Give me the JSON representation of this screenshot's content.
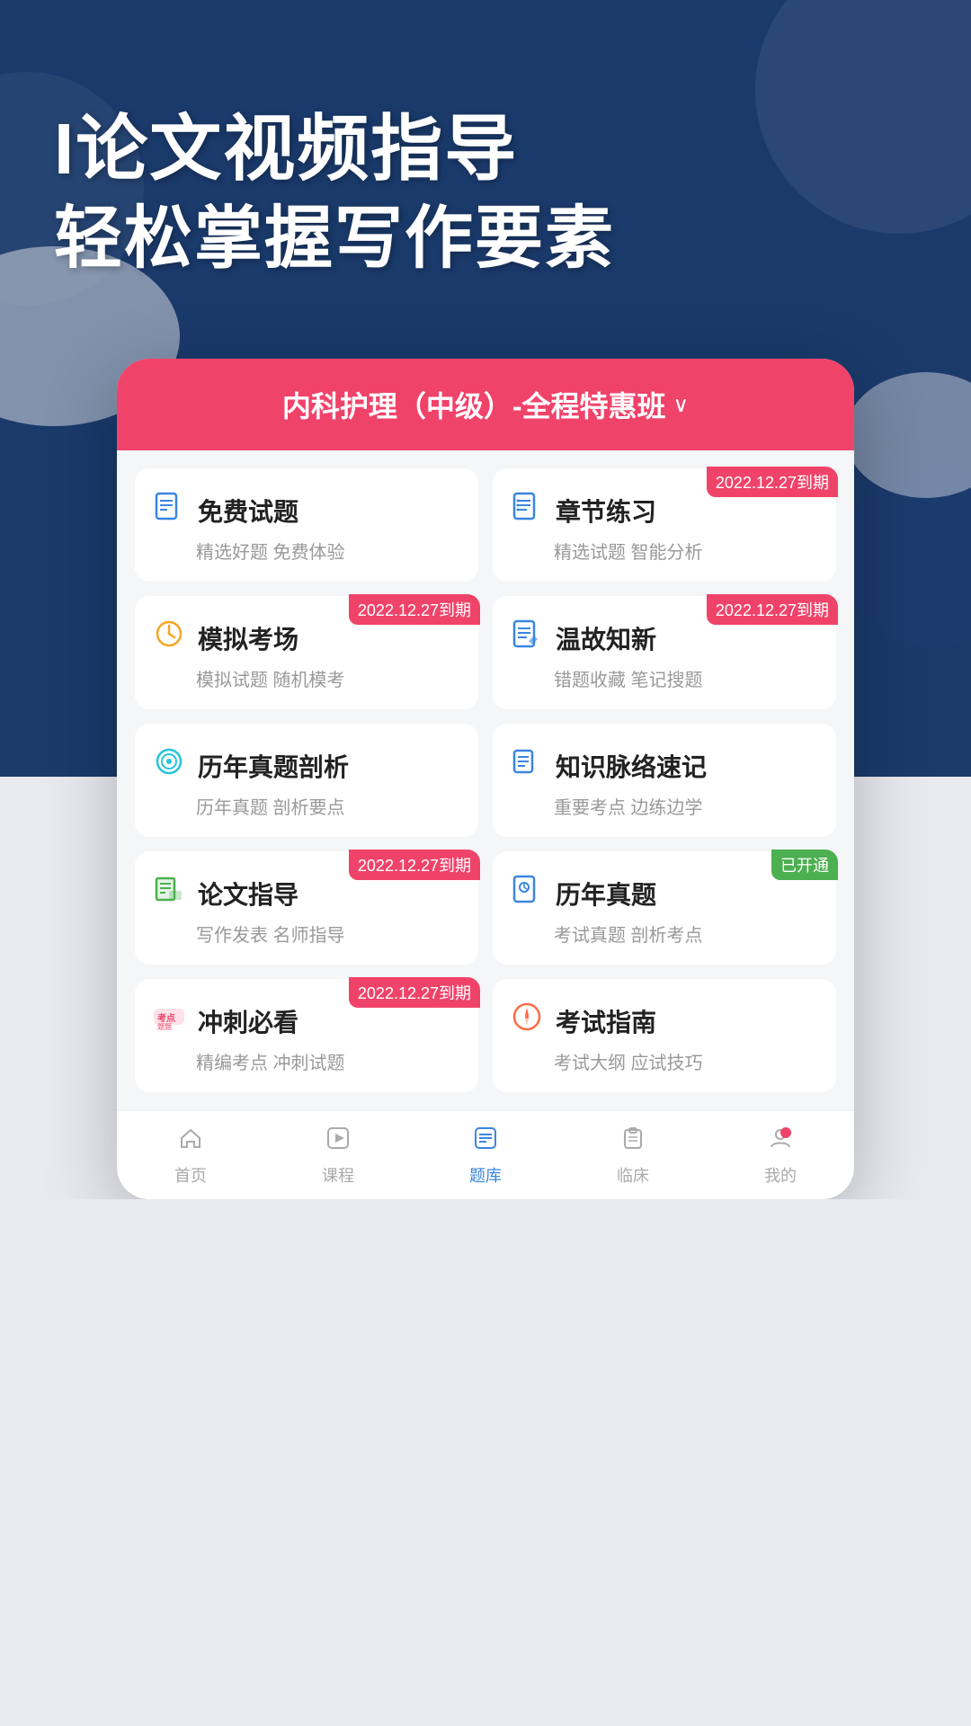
{
  "header": {
    "title_line1": "I论文视频指导",
    "title_line2": "轻松掌握写作要素"
  },
  "course": {
    "title": "内科护理（中级）-全程特惠班",
    "chevron": "∨"
  },
  "cards": [
    {
      "id": "free-questions",
      "title": "免费试题",
      "subtitle": "精选好题 免费体验",
      "icon_type": "doc-blue",
      "badge": null
    },
    {
      "id": "chapter-practice",
      "title": "章节练习",
      "subtitle": "精选试题 智能分析",
      "icon_type": "list-blue",
      "badge": "2022.12.27到期"
    },
    {
      "id": "mock-exam",
      "title": "模拟考场",
      "subtitle": "模拟试题 随机模考",
      "icon_type": "clock-orange",
      "badge": "2022.12.27到期"
    },
    {
      "id": "review-new",
      "title": "温故知新",
      "subtitle": "错题收藏 笔记搜题",
      "icon_type": "edit-blue",
      "badge": "2022.12.27到期"
    },
    {
      "id": "past-analysis",
      "title": "历年真题剖析",
      "subtitle": "历年真题 剖析要点",
      "icon_type": "target-cyan",
      "badge": null
    },
    {
      "id": "knowledge-map",
      "title": "知识脉络速记",
      "subtitle": "重要考点 边练边学",
      "icon_type": "list-blue",
      "badge": null
    },
    {
      "id": "paper-guidance",
      "title": "论文指导",
      "subtitle": "写作发表 名师指导",
      "icon_type": "paper-green",
      "badge": "2022.12.27到期"
    },
    {
      "id": "past-papers",
      "title": "历年真题",
      "subtitle": "考试真题 剖析考点",
      "icon_type": "history-blue",
      "badge": "已开通",
      "badge_green": true
    },
    {
      "id": "sprint-must-watch",
      "title": "冲刺必看",
      "subtitle": "精编考点 冲刺试题",
      "icon_type": "hotpoint-red",
      "badge": "2022.12.27到期"
    },
    {
      "id": "exam-guide",
      "title": "考试指南",
      "subtitle": "考试大纲 应试技巧",
      "icon_type": "compass-coral",
      "badge": null
    }
  ],
  "nav": {
    "items": [
      {
        "id": "home",
        "label": "首页",
        "icon": "home",
        "active": false
      },
      {
        "id": "course",
        "label": "课程",
        "icon": "play",
        "active": false
      },
      {
        "id": "question-bank",
        "label": "题库",
        "icon": "questions",
        "active": true
      },
      {
        "id": "clinical",
        "label": "临床",
        "icon": "clipboard",
        "active": false
      },
      {
        "id": "mine",
        "label": "我的",
        "icon": "user",
        "active": false,
        "has_badge": true
      }
    ]
  }
}
